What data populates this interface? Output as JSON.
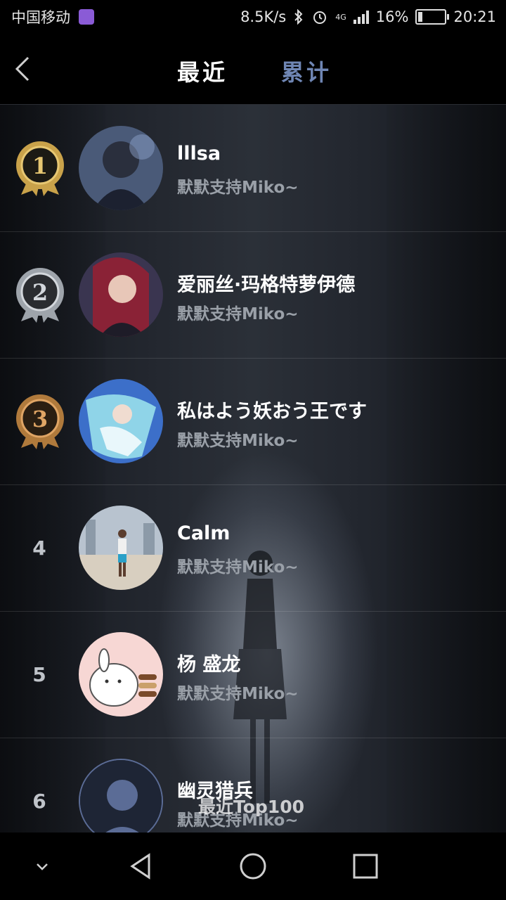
{
  "status_bar": {
    "carrier": "中国移动",
    "speed": "8.5K/s",
    "network": "4G",
    "battery": "16%",
    "time": "20:21"
  },
  "header": {
    "back_icon": "back-chevron-icon",
    "tabs": [
      {
        "label": "最近",
        "active": false
      },
      {
        "label": "累计",
        "active": true
      }
    ]
  },
  "list": [
    {
      "rank": "1",
      "medal": "gold",
      "name": "lllsa",
      "message": "默默支持Miko~"
    },
    {
      "rank": "2",
      "medal": "silver",
      "name": "爱丽丝·玛格特萝伊德",
      "message": "默默支持Miko~"
    },
    {
      "rank": "3",
      "medal": "bronze",
      "name": "私はよう妖おう王です",
      "message": "默默支持Miko~"
    },
    {
      "rank": "4",
      "medal": "",
      "name": "Calm",
      "message": "默默支持Miko~"
    },
    {
      "rank": "5",
      "medal": "",
      "name": "杨 盛龙",
      "message": "默默支持Miko~"
    },
    {
      "rank": "6",
      "medal": "",
      "name": "幽灵猎兵",
      "message": "默默支持Miko~"
    }
  ],
  "footer_label": "最近Top100",
  "nav": {
    "collapse_icon": "chevron-down-icon",
    "back_icon": "triangle-back-icon",
    "home_icon": "circle-home-icon",
    "recents_icon": "square-recents-icon"
  },
  "colors": {
    "active_tab": "#ffffff",
    "inactive_tab": "#6f86b4",
    "gold": "#c9a24a",
    "silver": "#9ea4ab",
    "bronze": "#b07a3c"
  }
}
